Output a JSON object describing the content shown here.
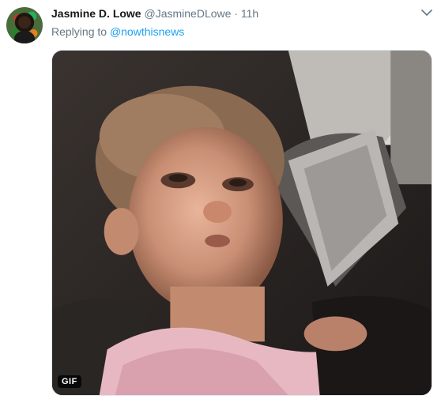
{
  "tweet": {
    "display_name": "Jasmine D. Lowe",
    "handle": "@JasmineDLowe",
    "separator": "·",
    "time": "11h",
    "reply_prefix": "Replying to",
    "reply_to": "@nowthisnews",
    "media_badge": "GIF",
    "menu_icon": "chevron-down-icon",
    "accent_color": "#1da1f2"
  }
}
